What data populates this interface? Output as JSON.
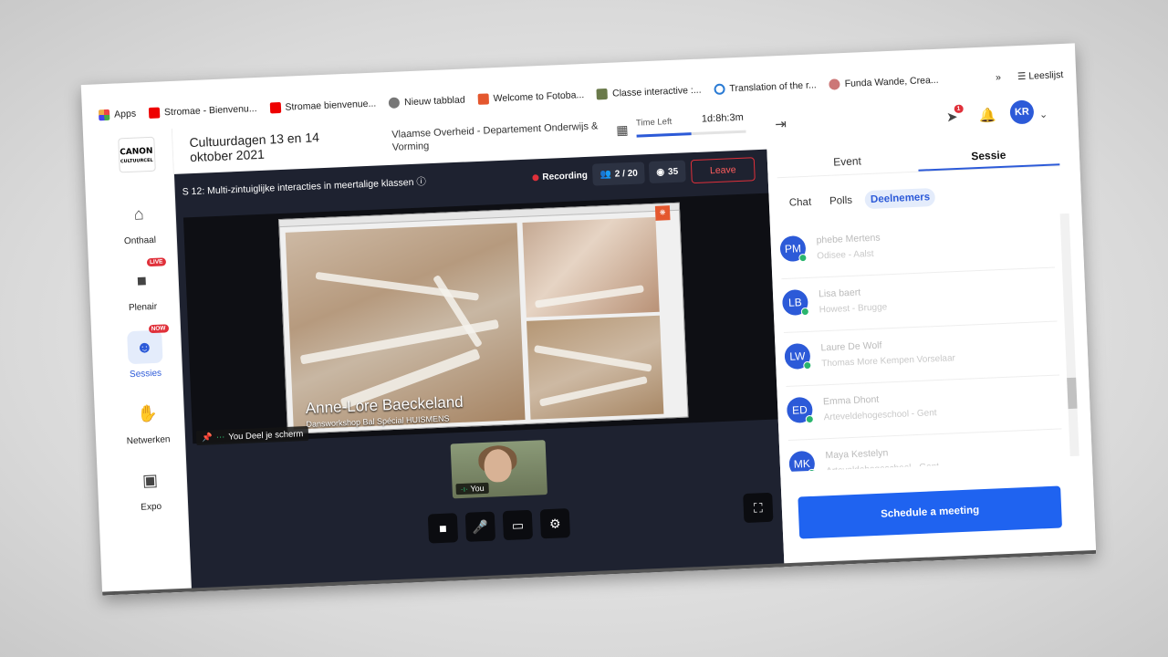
{
  "bookmarks": {
    "items": [
      {
        "label": "Apps",
        "color": "#e44"
      },
      {
        "label": "Stromae - Bienvenu...",
        "color": "#e00"
      },
      {
        "label": "Stromae bienvenue...",
        "color": "#e00"
      },
      {
        "label": "Nieuw tabblad",
        "color": "#777"
      },
      {
        "label": "Welcome to Fotoba...",
        "color": "#e4572e"
      },
      {
        "label": "Classe interactive :...",
        "color": "#6a7a4a"
      },
      {
        "label": "Translation of the r...",
        "color": "#2a7bd4"
      },
      {
        "label": "Funda Wande, Crea...",
        "color": "#c77"
      }
    ],
    "more": "»",
    "reading_list": "Leeslijst"
  },
  "nav": {
    "logo_line1": "CANON",
    "logo_line2": "CULTUURCEL",
    "items": [
      {
        "label": "Onthaal",
        "icon": "home-icon",
        "glyph": "⌂",
        "badge": ""
      },
      {
        "label": "Plenair",
        "icon": "video-icon",
        "glyph": "■",
        "badge": "LIVE"
      },
      {
        "label": "Sessies",
        "icon": "group-icon",
        "glyph": "☻",
        "badge": "NOW"
      },
      {
        "label": "Netwerken",
        "icon": "handshake-icon",
        "glyph": "✋",
        "badge": ""
      },
      {
        "label": "Expo",
        "icon": "store-icon",
        "glyph": "▣",
        "badge": ""
      }
    ]
  },
  "header": {
    "event_title": "Cultuurdagen 13 en 14 oktober 2021",
    "organizer": "Vlaamse Overheid - Departement Onderwijs & Vorming",
    "time_left_label": "Time Left",
    "time_left_value": "1d:8h:3m",
    "time_left_progress": 0.5
  },
  "session": {
    "title": "S 12: Multi-zintuiglijke interacties in meertalige klassen",
    "recording_label": "Recording",
    "attendees": "2 / 20",
    "views": "35",
    "leave_label": "Leave",
    "caption_name": "Anne-Lore Baeckeland",
    "caption_sub": "Dansworkshop Bal Spécial HUISMENS",
    "share_label": "You Deel je scherm",
    "self_label": "You"
  },
  "panel": {
    "tabs": [
      "Event",
      "Sessie"
    ],
    "active_tab": "Sessie",
    "subtabs": [
      "Chat",
      "Polls",
      "Deelnemers"
    ],
    "active_subtab": "Deelnemers",
    "notification_count": "1",
    "user_initials": "KR",
    "participants": [
      {
        "initials": "PM",
        "name": "phebe Mertens",
        "org": "Odisee - Aalst"
      },
      {
        "initials": "LB",
        "name": "Lisa baert",
        "org": "Howest - Brugge"
      },
      {
        "initials": "LW",
        "name": "Laure De Wolf",
        "org": "Thomas More Kempen Vorselaar"
      },
      {
        "initials": "ED",
        "name": "Emma Dhont",
        "org": "Arteveldehogeschool - Gent"
      },
      {
        "initials": "MK",
        "name": "Maya Kestelyn",
        "org": "Arteveldehogeschool - Gent"
      }
    ],
    "schedule_label": "Schedule a meeting"
  },
  "colors": {
    "accent": "#2c5ad8",
    "danger": "#e0303a",
    "online": "#2ab56d"
  }
}
